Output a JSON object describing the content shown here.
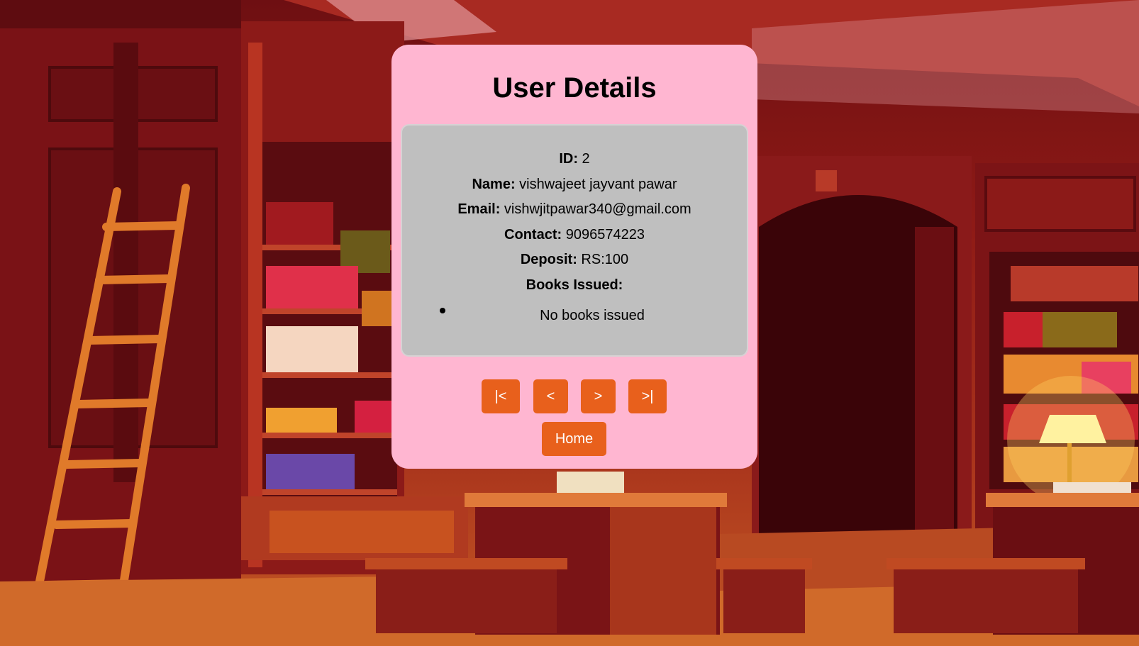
{
  "page": {
    "title": "User Details"
  },
  "user": {
    "id_label": "ID:",
    "id_value": "2",
    "name_label": "Name:",
    "name_value": "vishwajeet jayvant pawar",
    "email_label": "Email:",
    "email_value": "vishwjitpawar340@gmail.com",
    "contact_label": "Contact:",
    "contact_value": "9096574223",
    "deposit_label": "Deposit:",
    "deposit_value": "RS:100",
    "books_label": "Books Issued:",
    "books_items": [
      "No books issued"
    ]
  },
  "pager": {
    "first_label": "|<",
    "prev_label": "<",
    "next_label": ">",
    "last_label": ">|"
  },
  "home": {
    "label": "Home"
  },
  "colors": {
    "card_bg": "#ffb6d1",
    "details_bg": "#bfbfbf",
    "button_bg": "#e8601c",
    "button_text": "#ffffff"
  }
}
